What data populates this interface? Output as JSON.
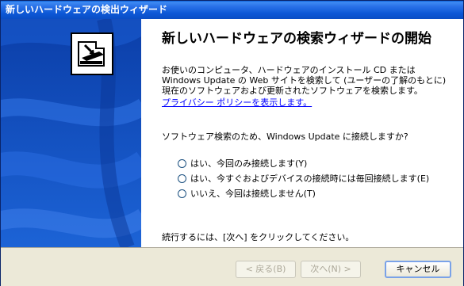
{
  "window": {
    "title": "新しいハードウェアの検出ウィザード"
  },
  "wizard": {
    "heading": "新しいハードウェアの検索ウィザードの開始",
    "intro": "お使いのコンピュータ、ハードウェアのインストール CD または Windows Update の Web サイトを検索して (ユーザーの了解のもとに) 現在のソフトウェアおよび更新されたソフトウェアを検索します。",
    "privacy_link": "プライバシー ポリシーを表示します。",
    "question": "ソフトウェア検索のため、Windows Update に接続しますか?",
    "options": [
      {
        "label": "はい、今回のみ接続します(Y)",
        "selected": false
      },
      {
        "label": "はい、今すぐおよびデバイスの接続時には毎回接続します(E)",
        "selected": false
      },
      {
        "label": "いいえ、今回は接続しません(T)",
        "selected": false
      }
    ],
    "footer_text": "続行するには、[次へ] をクリックしてください。"
  },
  "buttons": {
    "back": "< 戻る(B)",
    "next": "次へ(N) >",
    "cancel": "キャンセル"
  },
  "icon": "hardware-install-icon"
}
